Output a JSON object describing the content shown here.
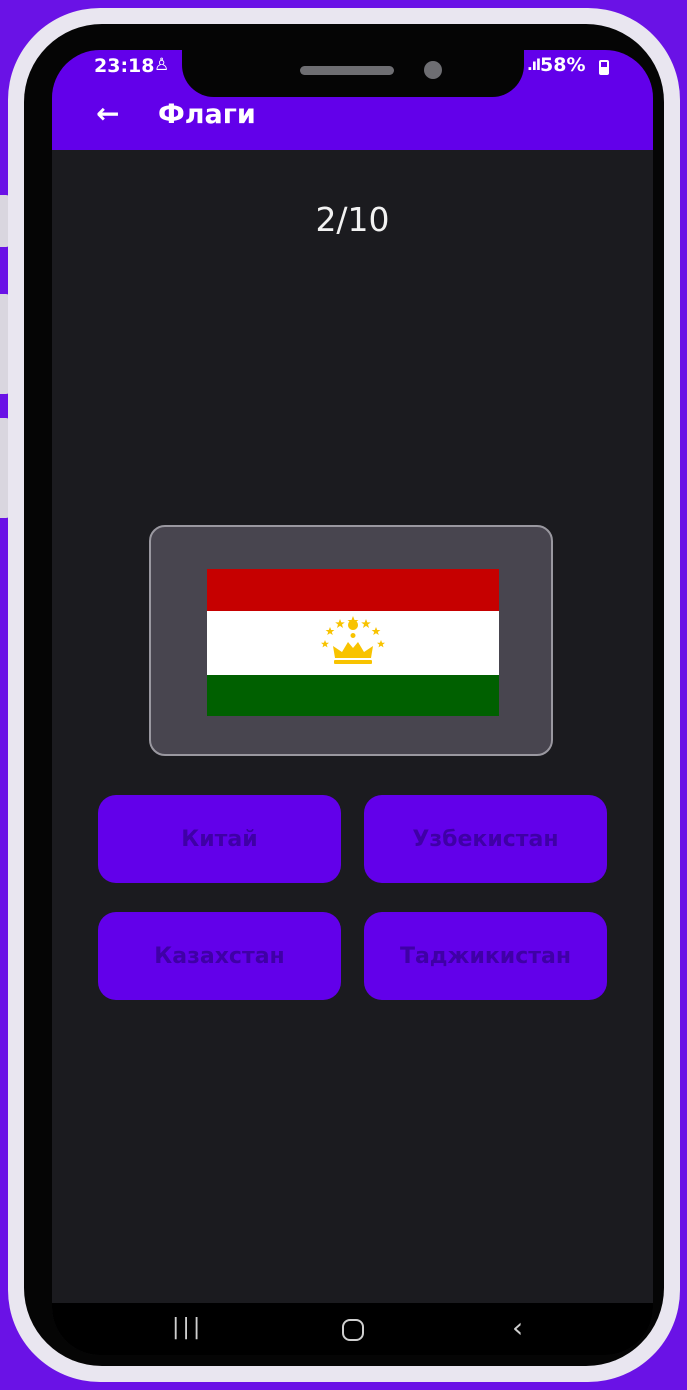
{
  "status_bar": {
    "time": "23:18",
    "notification_icon": "person-icon",
    "signal": ".ıl",
    "battery": "58%"
  },
  "app_bar": {
    "back_icon": "arrow-left-icon",
    "back_glyph": "←",
    "title": "Флаги"
  },
  "quiz": {
    "progress": "2/10",
    "flag_icon": "flag-of-tajikistan",
    "answers": [
      "Китай",
      "Узбекистан",
      "Казахстан",
      "Таджикистан"
    ]
  },
  "nav_bar": {
    "recent_glyph": "|||",
    "back_glyph": "‹"
  },
  "colors": {
    "frame": "#6a12e6",
    "app_bar": "#6200ea",
    "background": "#1b1b1f",
    "card": "#48454f",
    "answer_button": "#6200ea",
    "answer_text": "#3f00a6"
  }
}
